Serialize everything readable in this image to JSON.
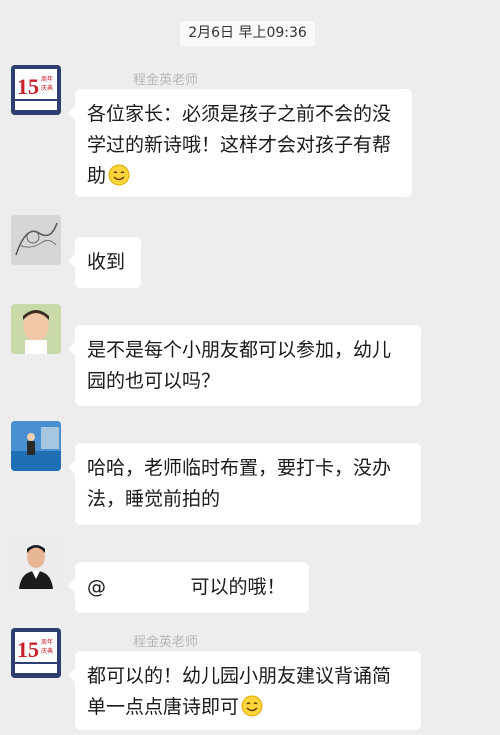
{
  "chat": {
    "timestamp": "2月6日 早上09:36",
    "messages": [
      {
        "sender": "程金英老师",
        "avatar": "brand-logo-avatar",
        "text": "各位家长：必须是孩子之前不会的没学过的新诗哦！这样才会对孩子有帮助",
        "emoji": "smiling-face"
      },
      {
        "sender": "",
        "avatar": "sketch-avatar",
        "text": "收到"
      },
      {
        "sender": "",
        "avatar": "child-photo-avatar",
        "text": "是不是每个小朋友都可以参加，幼儿园的也可以吗？"
      },
      {
        "sender": "",
        "avatar": "room-photo-avatar",
        "text": "哈哈，老师临时布置，要打卡，没办法，睡觉前拍的"
      },
      {
        "sender": "",
        "avatar": "man-in-suit-avatar",
        "text": "@ 可以的哦！"
      },
      {
        "sender": "程金英老师",
        "avatar": "brand-logo-avatar",
        "text": "都可以的！幼儿园小朋友建议背诵简单一点点唐诗即可",
        "emoji": "smiling-face"
      }
    ]
  },
  "logo": {
    "number": "15",
    "badge": "周年 庆典"
  }
}
